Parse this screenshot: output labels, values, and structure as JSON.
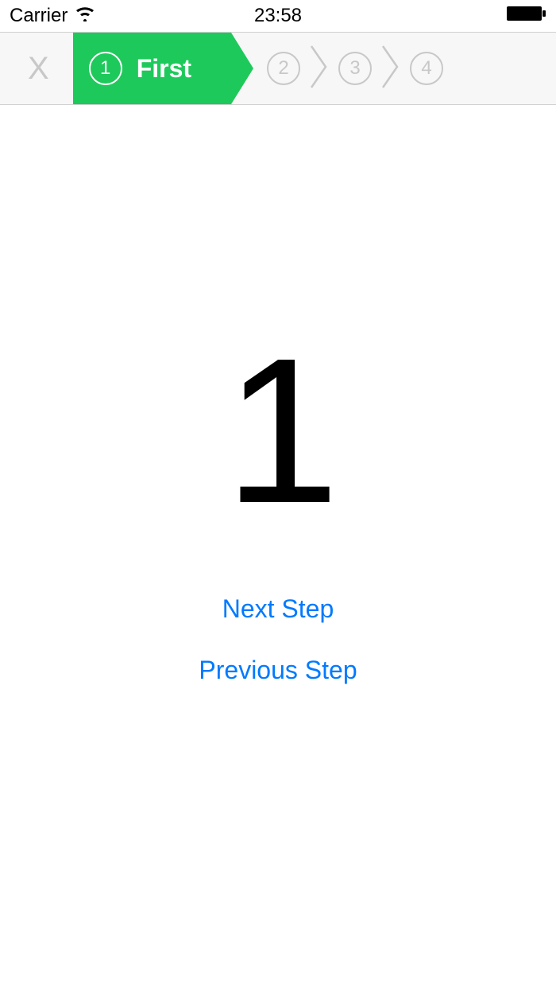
{
  "statusBar": {
    "carrier": "Carrier",
    "time": "23:58"
  },
  "navBar": {
    "closeLabel": "X",
    "steps": [
      {
        "num": "1",
        "label": "First",
        "active": true
      },
      {
        "num": "2",
        "label": "",
        "active": false
      },
      {
        "num": "3",
        "label": "",
        "active": false
      },
      {
        "num": "4",
        "label": "",
        "active": false
      }
    ]
  },
  "content": {
    "currentStepDisplay": "1",
    "nextLabel": "Next Step",
    "prevLabel": "Previous Step"
  }
}
